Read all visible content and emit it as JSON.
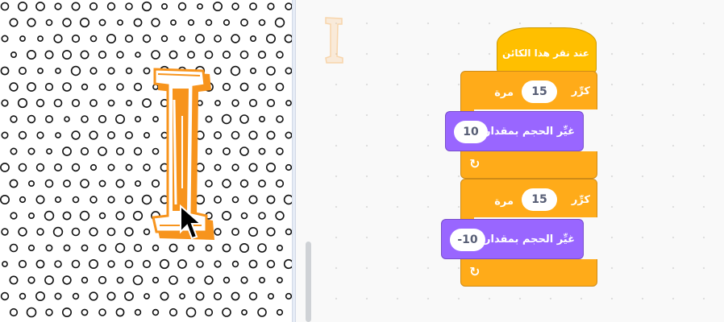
{
  "stage": {
    "sprite_name": "letter-I-sprite",
    "backdrop": "polka-dot-circles"
  },
  "thumbnail": {
    "sprite_icon": "letter-I-thumbnail"
  },
  "script": {
    "hat_block": {
      "label": "عند نقر هذا الكائن"
    },
    "repeat_1": {
      "label_repeat": "كرِّر",
      "count": "15",
      "label_times": "مرة",
      "inner": {
        "label": "غيِّر الحجم بمقدار",
        "value": "10"
      }
    },
    "repeat_2": {
      "label_repeat": "كرِّر",
      "count": "15",
      "label_times": "مرة",
      "inner": {
        "label": "غيِّر الحجم بمقدار",
        "value": "-10"
      }
    },
    "loop_arrow_icon": "↻"
  },
  "colors": {
    "control": "#ffab19",
    "looks": "#9966ff",
    "events": "#ffbf00",
    "sprite_orange": "#f7941d"
  }
}
